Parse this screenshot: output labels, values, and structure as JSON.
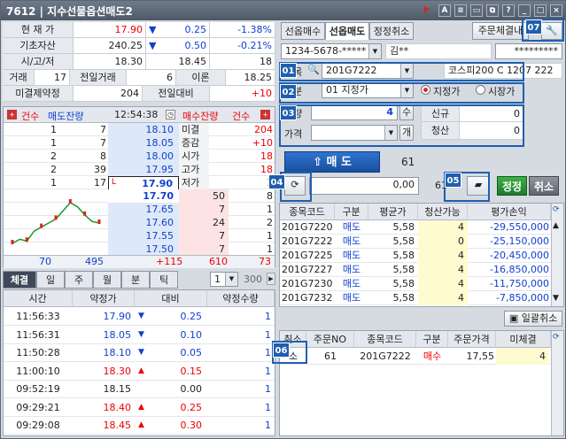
{
  "window": {
    "code": "7612",
    "title": "지수선물옵션매도2"
  },
  "quote": {
    "rows": [
      {
        "label": "현 재 가",
        "price": "17.90",
        "arrow": "▼",
        "change": "0.25",
        "pct": "-1.38%"
      },
      {
        "label": "기초자산",
        "price": "240.25",
        "arrow": "▼",
        "change": "0.50",
        "pct": "-0.21%"
      },
      {
        "label": "시/고/저",
        "price": "18.30",
        "change": "18.45",
        "pct": "18"
      }
    ],
    "volume_label": "거래",
    "volume": "17",
    "prev_volume_label": "전일거래",
    "prev_volume": "6",
    "theory_label": "이론",
    "theory": "18.25",
    "oi_label": "미결제약정",
    "oi": "204",
    "prev_diff_label": "전일대비",
    "prev_diff": "+10"
  },
  "orderbook": {
    "ask_count_label": "건수",
    "ask_qty_label": "매도잔량",
    "time": "12:54:38",
    "bid_qty_label": "매수잔량",
    "bid_count_label": "건수",
    "asks": [
      {
        "count": "1",
        "qty": "7",
        "price": "18.10"
      },
      {
        "count": "1",
        "qty": "7",
        "price": "18.05"
      },
      {
        "count": "2",
        "qty": "8",
        "price": "18.00"
      },
      {
        "count": "2",
        "qty": "39",
        "price": "17.95"
      },
      {
        "count": "1",
        "qty": "17",
        "price": "17.90"
      }
    ],
    "current_marker": "L",
    "info": [
      {
        "label": "미결",
        "value": "204"
      },
      {
        "label": "증감",
        "value": "+10"
      },
      {
        "label": "시가",
        "value": "18"
      },
      {
        "label": "고가",
        "value": "18"
      },
      {
        "label": "저가",
        "value": "1"
      }
    ],
    "bids": [
      {
        "price": "17.70",
        "qty": "50",
        "count": "8"
      },
      {
        "price": "17.65",
        "qty": "7",
        "count": "1"
      },
      {
        "price": "17.60",
        "qty": "24",
        "count": "2"
      },
      {
        "price": "17.55",
        "qty": "7",
        "count": "1"
      },
      {
        "price": "17.50",
        "qty": "7",
        "count": "1"
      }
    ],
    "totals": {
      "ask_count": "70",
      "ask_qty": "495",
      "diff": "+115",
      "bid_qty": "610",
      "bid_count": "73"
    },
    "spark": [
      17.55,
      17.6,
      17.58,
      17.7,
      17.75,
      17.8,
      17.85,
      17.95,
      18.05,
      18.0,
      17.9,
      17.82,
      17.8
    ]
  },
  "ticks": {
    "tabs": [
      "체결",
      "일",
      "주",
      "월",
      "분",
      "틱"
    ],
    "unit": "1",
    "count": "300",
    "headers": [
      "시간",
      "약정가",
      "대비",
      "약정수량"
    ],
    "rows": [
      {
        "time": "11:56:33",
        "price": "17.90",
        "arrow": "▼",
        "diff": "0.25",
        "qty": "1"
      },
      {
        "time": "11:56:31",
        "price": "18.05",
        "arrow": "▼",
        "diff": "0.10",
        "qty": "1"
      },
      {
        "time": "11:50:28",
        "price": "18.10",
        "arrow": "▼",
        "diff": "0.05",
        "qty": "1"
      },
      {
        "time": "11:00:10",
        "price": "18.30",
        "arrow": "▲",
        "diff": "0.15",
        "qty": "1"
      },
      {
        "time": "09:52:19",
        "price": "18.15",
        "arrow": "",
        "diff": "0.00",
        "qty": "1"
      },
      {
        "time": "09:29:21",
        "price": "18.40",
        "arrow": "▲",
        "diff": "0.25",
        "qty": "1"
      },
      {
        "time": "09:29:08",
        "price": "18.45",
        "arrow": "▲",
        "diff": "0.30",
        "qty": "1"
      }
    ]
  },
  "order": {
    "tabs": [
      "선옵매수",
      "선옵매도",
      "정정취소"
    ],
    "cond_button": "주문체결내",
    "account": "1234-5678-*****",
    "name": "김**",
    "password": "*********",
    "code_label": "종목",
    "code": "201G7222",
    "code_name": "코스피200 C 1207 222",
    "type_label": "구분",
    "type": "01 지정가",
    "radio1": "지정가",
    "radio2": "시장가",
    "qty_label": "수량",
    "qty": "4",
    "qty_unit": "수",
    "price_label": "가격",
    "price_unit": "개",
    "new_label": "신규",
    "new_value": "0",
    "close_label": "청산",
    "close_value": "0",
    "sell_button": "매 도",
    "sell_qty": "61",
    "amount": "0,00",
    "amount_qty": "61",
    "modify_button": "정정",
    "cancel_button": "취소",
    "badges": [
      "01",
      "02",
      "03",
      "04",
      "05",
      "06",
      "07"
    ]
  },
  "positions": {
    "headers": [
      "종목코드",
      "구분",
      "평균가",
      "청산가능",
      "평가손익"
    ],
    "rows": [
      {
        "code": "201G7220",
        "side": "매도",
        "avg": "5,58",
        "avail": "4",
        "pl": "-29,550,000"
      },
      {
        "code": "201G7222",
        "side": "매도",
        "avg": "5,58",
        "avail": "0",
        "pl": "-25,150,000"
      },
      {
        "code": "201G7225",
        "side": "매도",
        "avg": "5,58",
        "avail": "4",
        "pl": "-20,450,000"
      },
      {
        "code": "201G7227",
        "side": "매도",
        "avg": "5,58",
        "avail": "4",
        "pl": "-16,850,000"
      },
      {
        "code": "201G7230",
        "side": "매도",
        "avg": "5,58",
        "avail": "4",
        "pl": "-11,750,000"
      },
      {
        "code": "201G7232",
        "side": "매도",
        "avg": "5,58",
        "avail": "4",
        "pl": "-7,850,000"
      }
    ]
  },
  "unfilled": {
    "bulk_cancel": "일괄취소",
    "headers": [
      "취소",
      "주문NO",
      "종목코드",
      "구분",
      "주문가격",
      "미체결"
    ],
    "rows": [
      {
        "cancel": "소",
        "no": "61",
        "code": "201G7222",
        "side": "매수",
        "price": "17,55",
        "remain": "4"
      }
    ]
  }
}
